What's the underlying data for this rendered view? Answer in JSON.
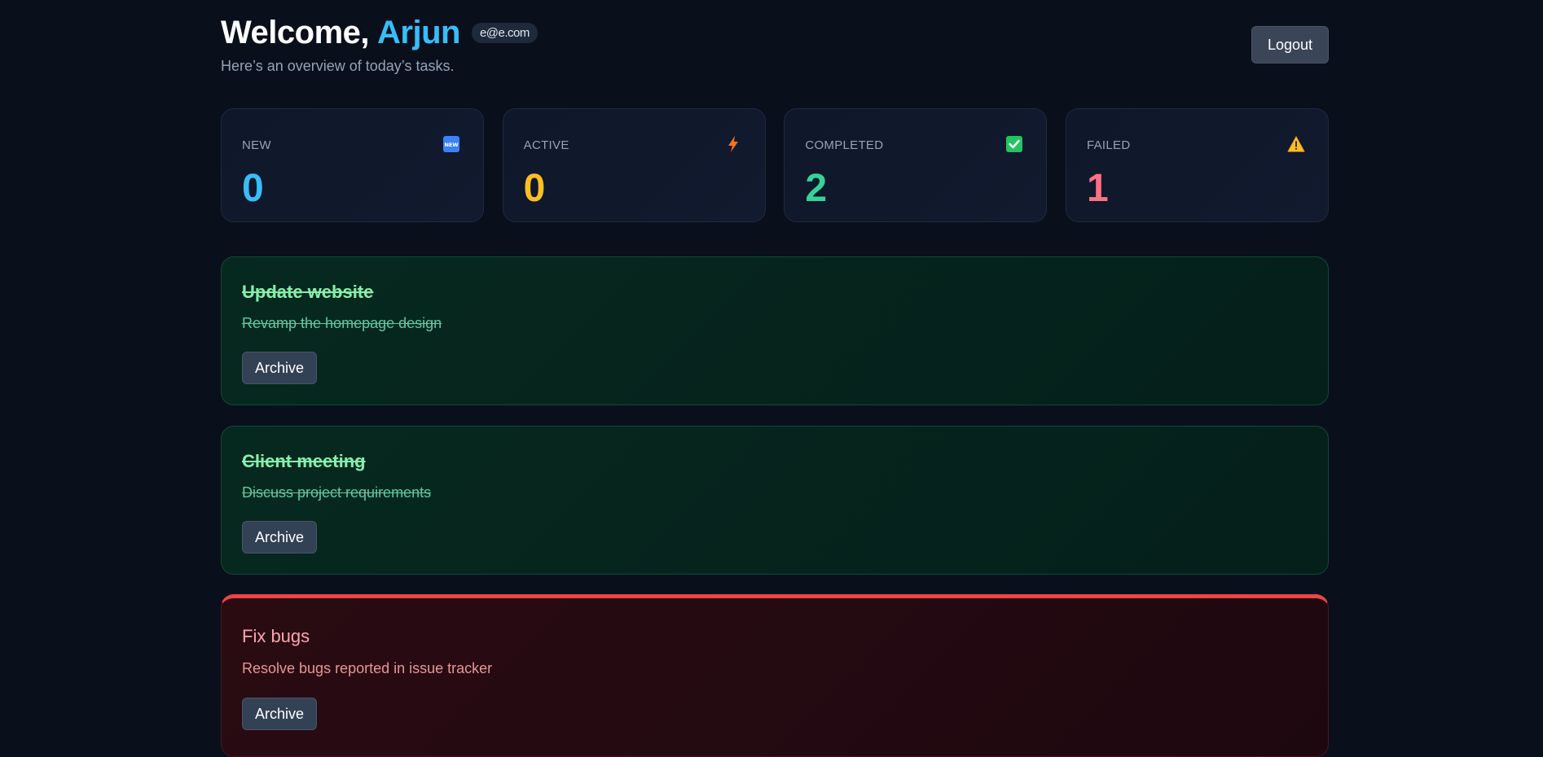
{
  "header": {
    "welcome_prefix": "Welcome,",
    "user_name": "Arjun",
    "email": "e@e.com",
    "subtitle": "Here’s an overview of today’s tasks.",
    "logout_label": "Logout"
  },
  "stats": [
    {
      "label": "NEW",
      "value": "0",
      "icon": "new-icon",
      "color": "#38bdf8"
    },
    {
      "label": "ACTIVE",
      "value": "0",
      "icon": "lightning-icon",
      "color": "#fbbf24"
    },
    {
      "label": "COMPLETED",
      "value": "2",
      "icon": "check-icon",
      "color": "#34d399"
    },
    {
      "label": "FAILED",
      "value": "1",
      "icon": "warning-icon",
      "color": "#fb7185"
    }
  ],
  "tasks": [
    {
      "title": "Update website",
      "description": "Revamp the homepage design",
      "status": "completed",
      "action_label": "Archive"
    },
    {
      "title": "Client meeting",
      "description": "Discuss project requirements",
      "status": "completed",
      "action_label": "Archive"
    },
    {
      "title": "Fix bugs",
      "description": "Resolve bugs reported in issue tracker",
      "status": "failed",
      "action_label": "Archive"
    }
  ]
}
